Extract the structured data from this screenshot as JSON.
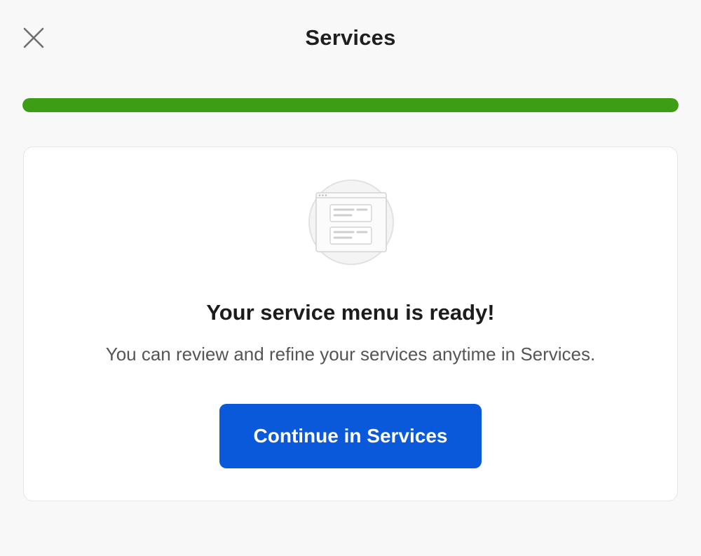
{
  "header": {
    "title": "Services",
    "close_icon": "close-icon"
  },
  "progress": {
    "value_percent": 100,
    "color": "#3d9e16"
  },
  "card": {
    "illustration_icon": "service-menu-illustration",
    "heading": "Your service menu is ready!",
    "description": "You can review and refine your services anytime in Services.",
    "button_label": "Continue in Services"
  },
  "colors": {
    "accent": "#0b59db",
    "background": "#f8f8f8",
    "card_background": "#ffffff"
  }
}
